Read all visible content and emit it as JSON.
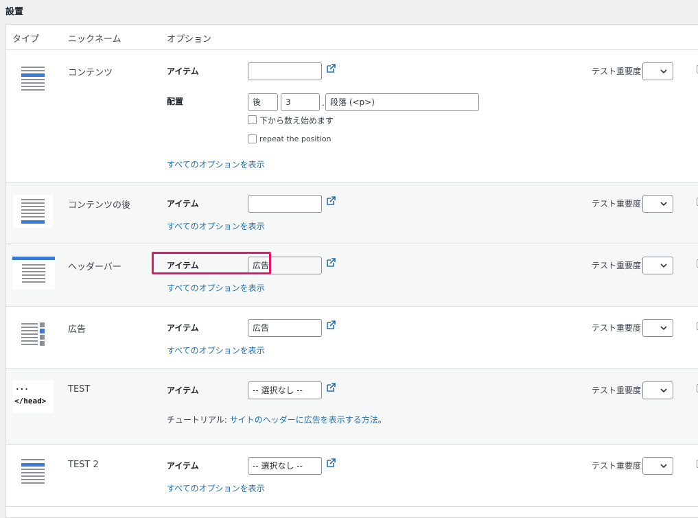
{
  "section_title": "設置",
  "columns": {
    "type": "タイプ",
    "nickname": "ニックネーム",
    "options": "オプション"
  },
  "common": {
    "item_label": "アイテム",
    "show_all": "すべてのオプションを表示",
    "test_priority": "テスト重要度"
  },
  "rows": [
    {
      "nickname": "コンテンツ",
      "icon": "content-placement-icon",
      "item_value": "",
      "placement_label": "配置",
      "position_value": "後",
      "count_value": "3",
      "tag_value": "段落 (<p>)",
      "check_from_bottom": "下から数え始めます",
      "check_repeat": "repeat the position"
    },
    {
      "nickname": "コンテンツの後",
      "icon": "after-content-icon",
      "item_value": ""
    },
    {
      "nickname": "ヘッダーバー",
      "icon": "header-bar-icon",
      "item_value": "広告"
    },
    {
      "nickname": "広告",
      "icon": "sidebar-widget-icon",
      "item_value": "広告"
    },
    {
      "nickname": "TEST",
      "icon": "head-code-icon",
      "icon_text_1": "...",
      "icon_text_2": "</head>",
      "item_value": "-- 選択なし --",
      "tutorial_prefix": "チュートリアル: ",
      "tutorial_link": "サイトのヘッダーに広告を表示する方法",
      "tutorial_suffix": "。"
    },
    {
      "nickname": "TEST 2",
      "icon": "before-content-icon",
      "item_value": "-- 選択なし --"
    }
  ],
  "colors": {
    "link": "#2271b1",
    "highlight": "#e5176b",
    "accent": "#3a7bd5"
  }
}
